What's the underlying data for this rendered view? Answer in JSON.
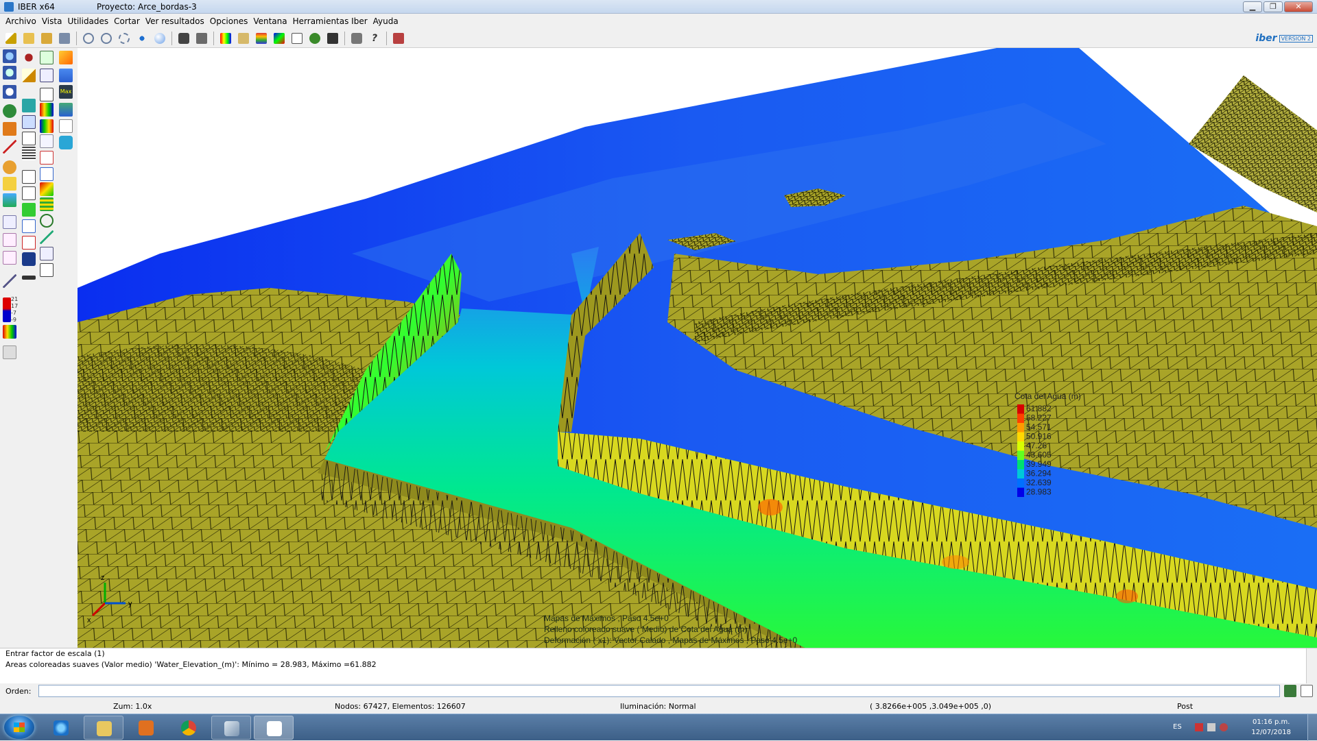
{
  "window": {
    "app_title": "IBER x64",
    "project_title": "Proyecto: Arce_bordas-3",
    "buttons": [
      "▁",
      "❐",
      "✕"
    ]
  },
  "menu": [
    "Archivo",
    "Vista",
    "Utilidades",
    "Cortar",
    "Ver resultados",
    "Opciones",
    "Ventana",
    "Herramientas Iber",
    "Ayuda"
  ],
  "brand": {
    "name": "iber",
    "version": "VERSION 2"
  },
  "legend": {
    "title": "Cota del Agua (m)",
    "values": [
      "61.882",
      "58.227",
      "54.571",
      "50.916",
      "47.26",
      "43.605",
      "39.949",
      "36.294",
      "32.639",
      "28.983"
    ],
    "colors": [
      "#d80000",
      "#ff4000",
      "#ff9a00",
      "#ffd800",
      "#d8ff00",
      "#60ff20",
      "#00e070",
      "#00c8d8",
      "#0070ff",
      "#0000e8"
    ]
  },
  "left_legend_labels": [
    "21",
    "17",
    "-7",
    "-9"
  ],
  "viewport_notes": [
    "Mapas de Máximos , Paso 4.5e+0",
    "Relleno coloreado suave ( Medio) de Cota del Agua (m)",
    "Deformación ( x1): Vector Calado , Mapas de Máximos , Paso 4.5e+0"
  ],
  "axes": {
    "z": "z",
    "x": "x",
    "y": "y"
  },
  "command_output": [
    "Entrar factor de escala (1)",
    "Areas coloreadas suaves (Valor medio) 'Water_Elevation_(m)': Mínimo = 28.983, Máximo =61.882"
  ],
  "order": {
    "label": "Orden:",
    "value": ""
  },
  "status": {
    "zoom": "Zum: 1.0x",
    "mesh": "Nodos: 67427, Elementos: 126607",
    "lighting": "Iluminación: Normal",
    "coords": "( 3.8266e+005 ,3.049e+005 ,0)",
    "mode": "Post"
  },
  "taskbar": {
    "language": "ES",
    "time": "01:16 p.m.",
    "date": "12/07/2018"
  },
  "colors": {
    "terrain": "#a9a428",
    "water_deep": "#0a2ef0",
    "water_mid": "#1e6ef5",
    "water_shallow": "#00e868",
    "water_very_shallow": "#2cff2c"
  }
}
